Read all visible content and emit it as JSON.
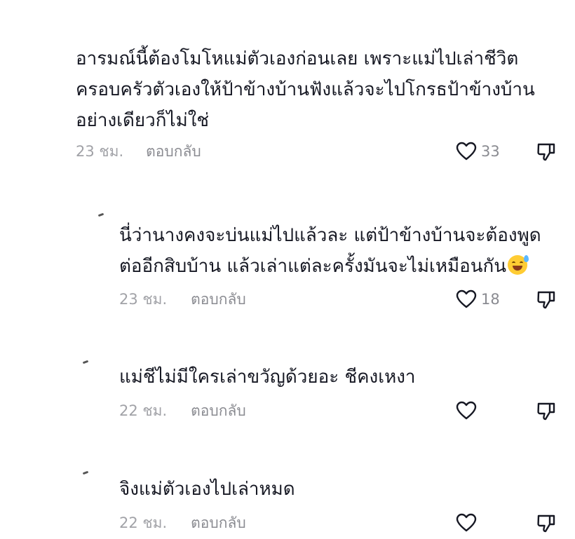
{
  "comments": [
    {
      "lines": [
        "อารมณ์นี้ต้องโมโหแม่ตัวเองก่อนเลย เพราะแม่ไปเล่าชีวิต",
        "ครอบครัวตัวเองให้ป้าข้างบ้านฟังแล้วจะไปโกรธป้าข้างบ้าน",
        "อย่างเดียวก็ไม่ใช่"
      ],
      "time": "23 ชม.",
      "reply": "ตอบกลับ",
      "likes": "33"
    },
    {
      "lines": [
        "นี่ว่านางคงจะบ่นแม่ไปแล้วละ แต่ป้าข้างบ้านจะต้องพูด",
        "ต่ออีกสิบบ้าน แล้วเล่าแต่ละครั้งมันจะไม่เหมือนกัน"
      ],
      "emoji": "grinning-sweat-emoji",
      "time": "23 ชม.",
      "reply": "ตอบกลับ",
      "likes": "18"
    },
    {
      "lines": [
        "แม่ชีไม่มีใครเล่าขวัญด้วยอะ ชีคงเหงา"
      ],
      "time": "22 ชม.",
      "reply": "ตอบกลับ",
      "likes": ""
    },
    {
      "lines": [
        "จิงแม่ตัวเองไปเล่าหมด"
      ],
      "time": "22 ชม.",
      "reply": "ตอบกลับ",
      "likes": ""
    }
  ],
  "icons": {
    "like": "heart-outline-icon",
    "dislike": "thumbs-down-outline-icon"
  },
  "colors": {
    "text": "#161823",
    "meta": "#a1a2a7",
    "icon": "#161823"
  }
}
